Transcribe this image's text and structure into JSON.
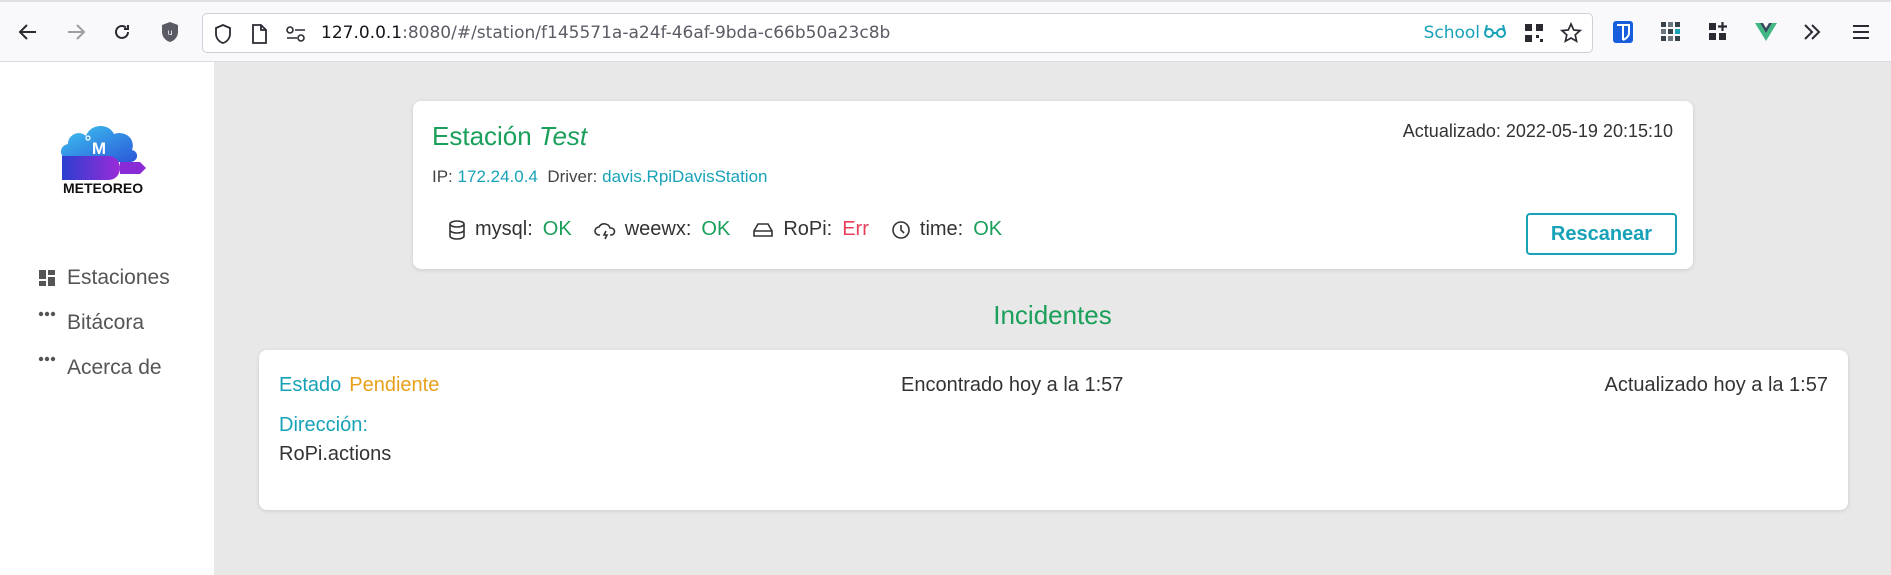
{
  "browser": {
    "url_host": "127.0.0.1",
    "url_rest": ":8080/#/station/f145571a-a24f-46af-9bda-c66b50a23c8b",
    "container_label": "School",
    "icons": [
      "back-icon",
      "forward-icon",
      "reload-icon",
      "ublock-icon",
      "shield-icon",
      "page-icon",
      "permissions-icon",
      "qr-icon",
      "star-icon",
      "bitwarden-icon",
      "extension-grid-icon",
      "add-app-icon",
      "vue-devtools-icon",
      "overflow-icon",
      "menu-icon"
    ]
  },
  "sidebar": {
    "logo_text": "METEOREO",
    "items": [
      {
        "label": "Estaciones",
        "icon": "dashboard-icon"
      },
      {
        "label": "Bitácora",
        "icon": "ellipsis-icon"
      },
      {
        "label": "Acerca de",
        "icon": "ellipsis-icon"
      }
    ]
  },
  "station": {
    "title_prefix": "Estación",
    "title_name": "Test",
    "updated": "Actualizado: 2022-05-19 20:15:10",
    "ip_label": "IP:",
    "ip_value": "172.24.0.4",
    "driver_label": "Driver:",
    "driver_value": "davis.RpiDavisStation",
    "status": [
      {
        "name": "mysql:",
        "value": "OK",
        "icon": "database-icon"
      },
      {
        "name": "weewx:",
        "value": "OK",
        "icon": "cloud-icon"
      },
      {
        "name": "RoPi:",
        "value": "Err",
        "icon": "harddrive-icon"
      },
      {
        "name": "time:",
        "value": "OK",
        "icon": "clock-icon"
      }
    ],
    "rescan_label": "Rescanear"
  },
  "incidents": {
    "title": "Incidentes",
    "items": [
      {
        "estado_label": "Estado",
        "estado_value": "Pendiente",
        "found": "Encontrado hoy a la 1:57",
        "updated": "Actualizado hoy a la 1:57",
        "direction_label": "Dirección:",
        "direction_value": "RoPi.actions"
      }
    ]
  },
  "colors": {
    "green": "#1aa05a",
    "cyan": "#17a2b8",
    "orange": "#e8a01a",
    "red": "#e83e5c"
  }
}
